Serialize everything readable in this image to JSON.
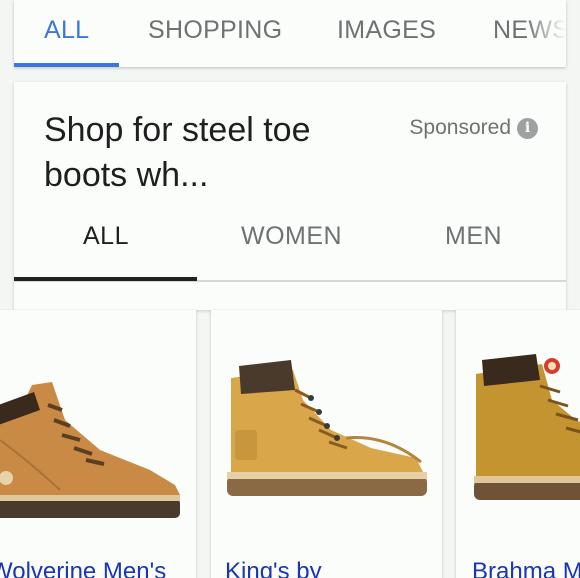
{
  "top_tabs": [
    {
      "label": "ALL"
    },
    {
      "label": "SHOPPING"
    },
    {
      "label": "IMAGES"
    },
    {
      "label": "NEWS"
    }
  ],
  "shopping": {
    "title": "Shop for steel toe boots wh...",
    "sponsored_label": "Sponsored",
    "info_icon": "i",
    "sub_tabs": [
      {
        "label": "ALL"
      },
      {
        "label": "WOMEN"
      },
      {
        "label": "MEN"
      }
    ]
  },
  "products": [
    {
      "name": "Wolverine Men's"
    },
    {
      "name": "King's by"
    },
    {
      "name": "Brahma M"
    }
  ],
  "colors": {
    "accent": "#3d78d8",
    "link": "#1a35b6",
    "boot_light": "#d9a74a",
    "boot_tan": "#c98a45"
  }
}
